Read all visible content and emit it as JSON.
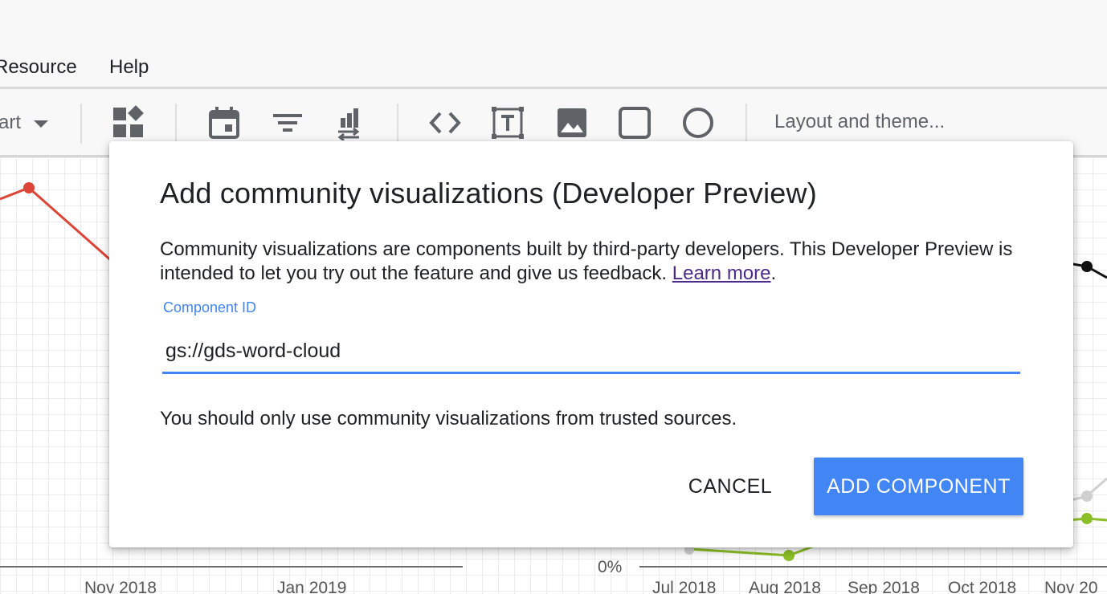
{
  "menubar": {
    "items": [
      {
        "label": "Resource"
      },
      {
        "label": "Help"
      }
    ]
  },
  "toolbar": {
    "chart_dropdown_label": "art",
    "layout_theme_label": "Layout and theme...",
    "icons": [
      "community-viz-icon",
      "date-range-icon",
      "filter-icon",
      "data-control-icon",
      "embed-icon",
      "text-box-icon",
      "image-icon",
      "rectangle-icon",
      "circle-icon"
    ]
  },
  "background_charts": {
    "left_x_ticks": [
      "Nov 2018",
      "Jan 2019"
    ],
    "right_y_tick": "0%",
    "right_x_ticks": [
      "Jul 2018",
      "Aug 2018",
      "Sep 2018",
      "Oct 2018",
      "Nov 20"
    ],
    "colors": {
      "red": "#db4437",
      "black": "#111111",
      "green": "#8cbf26",
      "gray": "#d0d0d0"
    }
  },
  "dialog": {
    "title": "Add community visualizations (Developer Preview)",
    "description": "Community visualizations are components built by third-party developers. This Developer Preview is intended to let you try out the feature and give us feedback.",
    "learn_more": "Learn more",
    "period": ".",
    "field_label": "Component ID",
    "field_value": "gs://gds-word-cloud",
    "note": "You should only use community visualizations from trusted sources.",
    "cancel_label": "CANCEL",
    "add_label": "ADD COMPONENT",
    "accent": "#4285f4"
  }
}
